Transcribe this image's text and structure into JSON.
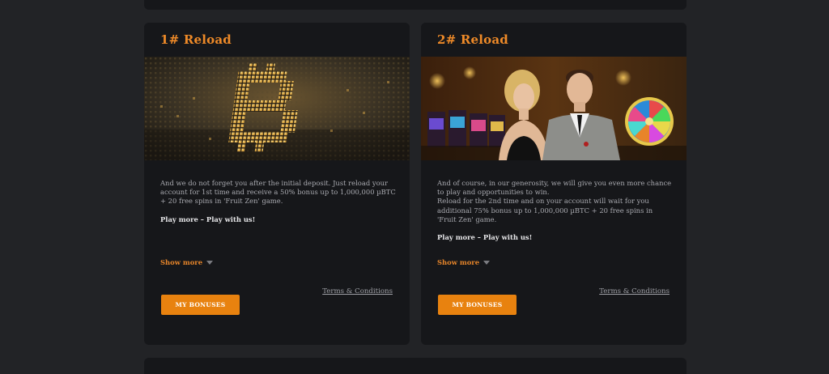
{
  "cards": [
    {
      "title": "1# Reload",
      "image_subject": "bitcoin-circuit-image",
      "description": "And we do not forget you after the initial deposit. Just reload your account for 1st time and receive a 50% bonus up to 1,000,000 µBTC + 20 free spins in 'Fruit Zen' game.",
      "tagline": "Play more – Play with us!",
      "show_more": "Show more",
      "terms": "Terms & Conditions",
      "button": "MY BONUSES"
    },
    {
      "title": "2# Reload",
      "image_subject": "casino-couple-image",
      "description_lines": [
        "And of course, in our generosity, we will give you even more chance to play and opportunities to win.",
        "Reload for the 2nd time and on your account will wait for you additional 75% bonus up to 1,000,000 µBTC + 20 free spins in 'Fruit Zen' game."
      ],
      "tagline": "Play more – Play with us!",
      "show_more": "Show more",
      "terms": "Terms & Conditions",
      "button": "MY BONUSES"
    }
  ],
  "colors": {
    "page_bg": "#222326",
    "card_bg": "#16171a",
    "accent": "#ee8a28",
    "button_bg": "#e8820f"
  }
}
